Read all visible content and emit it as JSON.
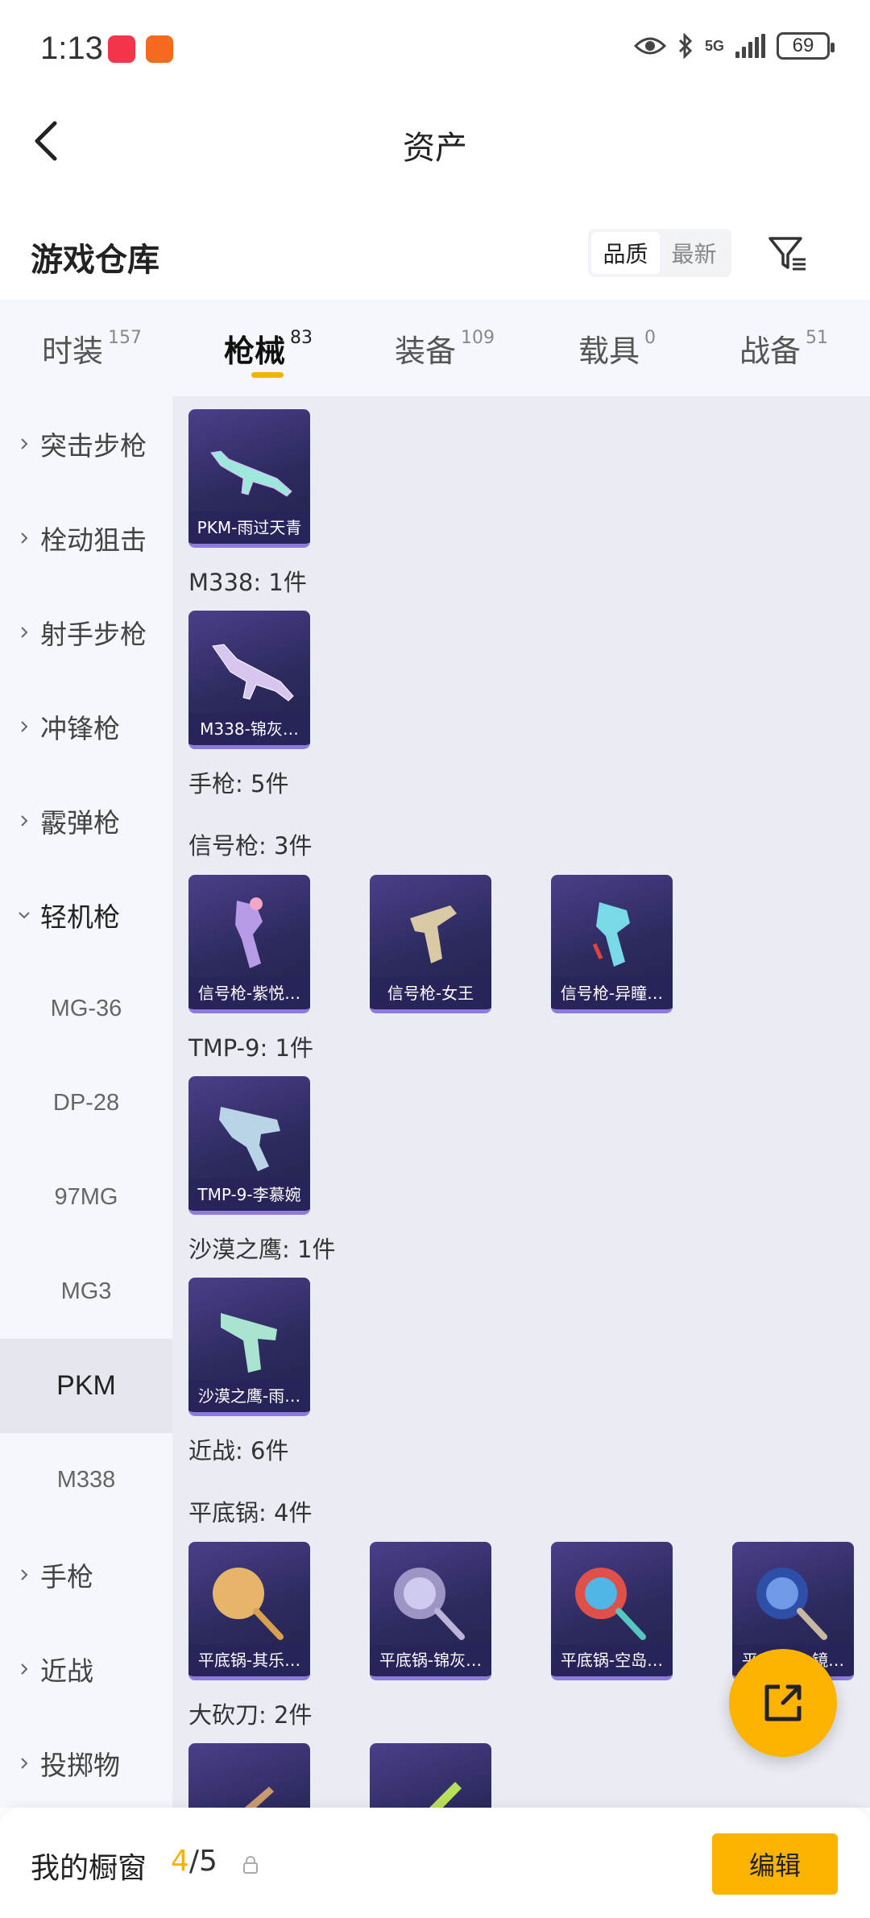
{
  "status_bar": {
    "time": "1:13",
    "network": "5G",
    "battery": "69"
  },
  "header": {
    "title": "资产"
  },
  "section": {
    "title": "游戏仓库",
    "sort_options": [
      "品质",
      "最新"
    ],
    "active_sort": "品质"
  },
  "tabs": [
    {
      "label": "时装",
      "count": "157"
    },
    {
      "label": "枪械",
      "count": "83"
    },
    {
      "label": "装备",
      "count": "109"
    },
    {
      "label": "载具",
      "count": "0"
    },
    {
      "label": "战备",
      "count": "51"
    }
  ],
  "active_tab": "枪械",
  "sidebar": {
    "categories": [
      "突击步枪",
      "栓动狙击",
      "射手步枪",
      "冲锋枪",
      "霰弹枪",
      "轻机枪"
    ],
    "subitems": [
      "MG-36",
      "DP-28",
      "97MG",
      "MG3",
      "PKM",
      "M338"
    ],
    "selected_subitem": "PKM",
    "more_categories": [
      "手枪",
      "近战",
      "投掷物"
    ]
  },
  "content": {
    "pkm_card": "PKM-雨过天青",
    "group_m338": "M338: 1件",
    "m338_card": "M338-锦灰…",
    "group_pistol": "手枪: 5件",
    "group_flare": "信号枪: 3件",
    "flare_cards": [
      "信号枪-紫悦…",
      "信号枪-女王",
      "信号枪-异瞳…"
    ],
    "group_tmp9": "TMP-9: 1件",
    "tmp9_card": "TMP-9-李慕婉",
    "group_deagle": "沙漠之鹰: 1件",
    "deagle_card": "沙漠之鹰-雨…",
    "group_melee": "近战: 6件",
    "group_pan": "平底锅: 4件",
    "pan_cards": [
      "平底锅-其乐…",
      "平底锅-锦灰…",
      "平底锅-空岛…",
      "平底锅-…镜…"
    ],
    "group_machete": "大砍刀: 2件"
  },
  "bottom_bar": {
    "label": "我的橱窗",
    "current": "4",
    "total": "/5",
    "edit_label": "编辑"
  },
  "colors": {
    "accent": "#fbb300",
    "card_bg": "#2d2a5e",
    "content_bg": "#e9edf3"
  }
}
